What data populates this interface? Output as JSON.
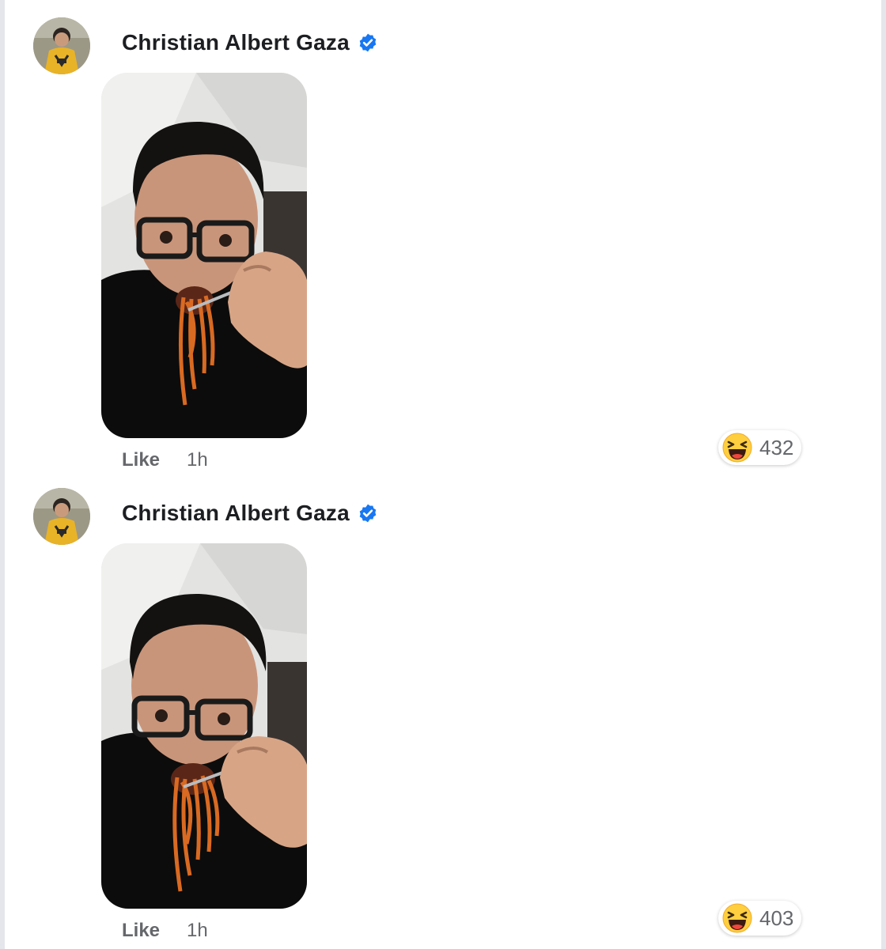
{
  "comments": [
    {
      "author": "Christian Albert Gaza",
      "verified": true,
      "like_label": "Like",
      "timestamp": "1h",
      "reaction": {
        "icon": "haha-emoji-icon",
        "count": "432"
      }
    },
    {
      "author": "Christian Albert Gaza",
      "verified": true,
      "like_label": "Like",
      "timestamp": "1h",
      "reaction": {
        "icon": "haha-emoji-icon",
        "count": "403"
      }
    }
  ],
  "colors": {
    "verified_badge": "#1877f2",
    "secondary_text": "#65676b",
    "author_text": "#1c1e21"
  }
}
